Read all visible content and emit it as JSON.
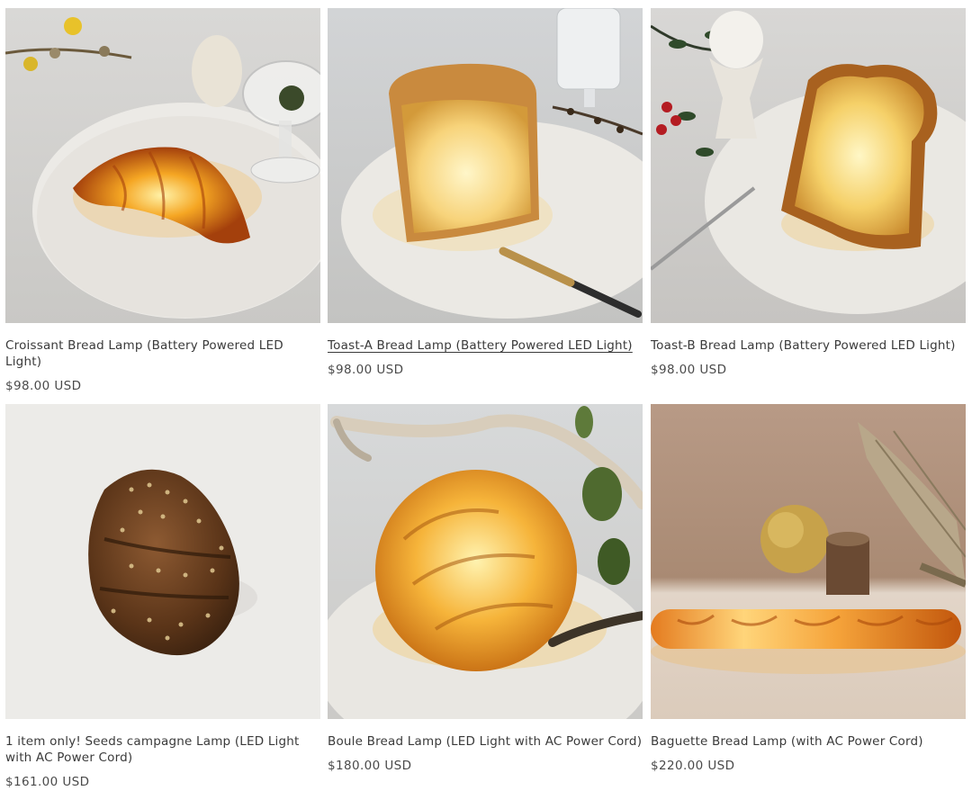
{
  "products": [
    {
      "title": "Croissant Bread Lamp (Battery Powered LED Light)",
      "price": "$98.00 USD",
      "image": "croissant-lamp-image"
    },
    {
      "title": "Toast-A Bread Lamp (Battery Powered LED Light)",
      "price": "$98.00 USD",
      "image": "toast-a-lamp-image",
      "hovered": true
    },
    {
      "title": "Toast-B Bread Lamp (Battery Powered LED Light)",
      "price": "$98.00 USD",
      "image": "toast-b-lamp-image"
    },
    {
      "title": "1 item only! Seeds campagne Lamp (LED Light with AC Power Cord)",
      "price": "$161.00 USD",
      "image": "seeds-campagne-lamp-image"
    },
    {
      "title": "Boule Bread Lamp (LED Light with AC Power Cord)",
      "price": "$180.00 USD",
      "image": "boule-lamp-image"
    },
    {
      "title": "Baguette Bread Lamp (with AC Power Cord)",
      "price": "$220.00 USD",
      "image": "baguette-lamp-image"
    }
  ],
  "colors": {
    "text": "#3a3a3a",
    "glow": "#f7b23b",
    "background": "#ffffff"
  }
}
